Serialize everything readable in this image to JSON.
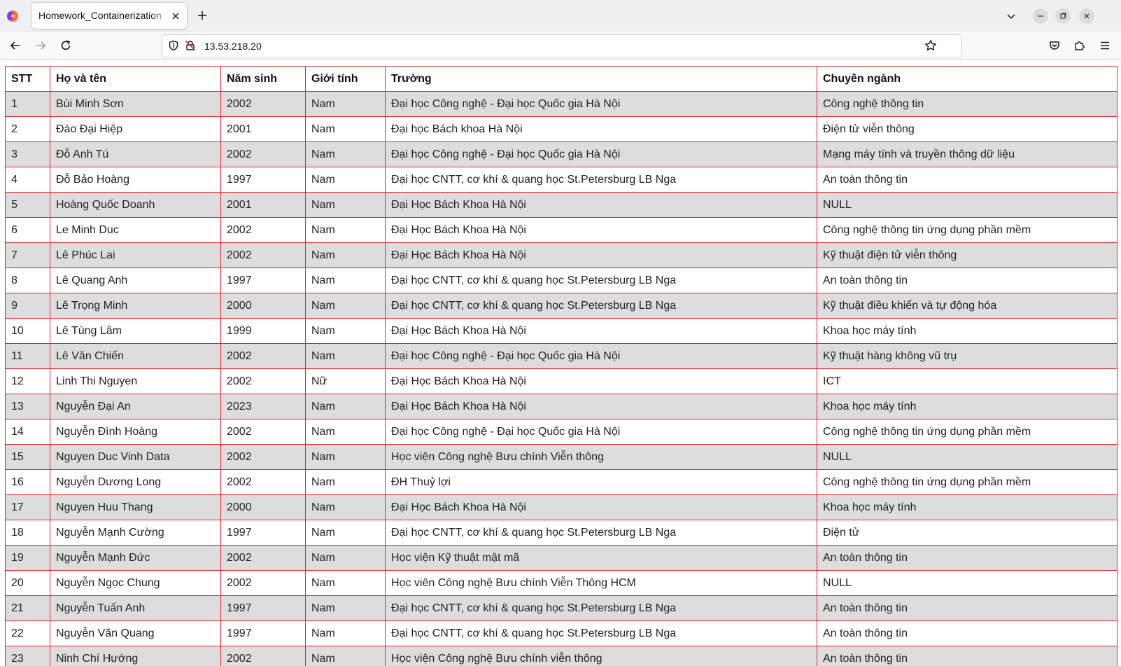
{
  "browser": {
    "tab_title": "Homework_Containerization",
    "url": "13.53.218.20"
  },
  "icons": {
    "back": "back-arrow-icon",
    "forward": "forward-arrow-icon",
    "reload": "reload-icon",
    "shield": "tracking-protection-icon",
    "lock": "insecure-lock-icon",
    "bookmark": "bookmark-star-icon",
    "pocket": "pocket-icon",
    "extensions": "extensions-icon",
    "menu": "hamburger-menu-icon"
  },
  "colors": {
    "table_border": "#e3232f",
    "row_stripe": "#dddddd"
  },
  "table": {
    "headers": [
      "STT",
      "Họ và tên",
      "Năm sinh",
      "Giới tính",
      "Trường",
      "Chuyên ngành"
    ],
    "rows": [
      [
        "1",
        "Bùi Minh Sơn",
        "2002",
        "Nam",
        "Đại học Công nghệ - Đại học Quốc gia Hà Nội",
        "Công nghệ thông tin"
      ],
      [
        "2",
        "Đào Đại Hiệp",
        "2001",
        "Nam",
        "Đại học Bách khoa Hà Nội",
        "Điện tử viễn thông"
      ],
      [
        "3",
        "Đỗ Anh Tú",
        "2002",
        "Nam",
        "Đại học Công nghệ - Đại học Quốc gia Hà Nội",
        "Mạng máy tính và truyền thông dữ liệu"
      ],
      [
        "4",
        "Đỗ Bảo Hoàng",
        "1997",
        "Nam",
        "Đại học CNTT, cơ khí & quang học St.Petersburg LB Nga",
        "An toàn thông tin"
      ],
      [
        "5",
        "Hoàng Quốc Doanh",
        "2001",
        "Nam",
        "Đại Học Bách Khoa Hà Nội",
        "NULL"
      ],
      [
        "6",
        "Le Minh Duc",
        "2002",
        "Nam",
        "Đại Học Bách Khoa Hà Nội",
        "Công nghệ thông tin ứng dụng phần mềm"
      ],
      [
        "7",
        "Lê Phúc Lai",
        "2002",
        "Nam",
        "Đại Học Bách Khoa Hà Nội",
        "Kỹ thuật điện tử viễn thông"
      ],
      [
        "8",
        "Lê Quang Anh",
        "1997",
        "Nam",
        "Đại học CNTT, cơ khí & quang học St.Petersburg LB Nga",
        "An toàn thông tin"
      ],
      [
        "9",
        "Lê Trọng Minh",
        "2000",
        "Nam",
        "Đại học CNTT, cơ khí & quang học St.Petersburg LB Nga",
        "Kỹ thuật điều khiển và tự động hóa"
      ],
      [
        "10",
        "Lê Tùng Lâm",
        "1999",
        "Nam",
        "Đại Học Bách Khoa Hà Nội",
        "Khoa học máy tính"
      ],
      [
        "11",
        "Lê Văn Chiến",
        "2002",
        "Nam",
        "Đại học Công nghệ - Đại học Quốc gia Hà Nội",
        "Kỹ thuật hàng không vũ trụ"
      ],
      [
        "12",
        "Linh Thi Nguyen",
        "2002",
        "Nữ",
        "Đại Học Bách Khoa Hà Nội",
        "ICT"
      ],
      [
        "13",
        "Nguyễn Đại An",
        "2023",
        "Nam",
        "Đại Học Bách Khoa Hà Nội",
        "Khoa học máy tính"
      ],
      [
        "14",
        "Nguyễn Đình Hoàng",
        "2002",
        "Nam",
        "Đại học Công nghệ - Đại học Quốc gia Hà Nội",
        "Công nghệ thông tin ứng dụng phần mềm"
      ],
      [
        "15",
        "Nguyen Duc Vinh Data",
        "2002",
        "Nam",
        "Học viện Công nghệ Bưu chính Viễn thông",
        "NULL"
      ],
      [
        "16",
        "Nguyễn Dương Long",
        "2002",
        "Nam",
        "ĐH Thuỷ lợi",
        "Công nghệ thông tin ứng dụng phần mềm"
      ],
      [
        "17",
        "Nguyen Huu Thang",
        "2000",
        "Nam",
        "Đại Học Bách Khoa Hà Nội",
        "Khoa học máy tính"
      ],
      [
        "18",
        "Nguyễn Mạnh Cường",
        "1997",
        "Nam",
        "Đại học CNTT, cơ khí & quang học St.Petersburg LB Nga",
        "Điện tử"
      ],
      [
        "19",
        "Nguyễn Mạnh Đức",
        "2002",
        "Nam",
        "Học viện Kỹ thuật mật mã",
        "An toàn thông tin"
      ],
      [
        "20",
        "Nguyễn Ngọc Chung",
        "2002",
        "Nam",
        "Học viên Công nghệ Bưu chính Viễn Thông HCM",
        "NULL"
      ],
      [
        "21",
        "Nguyễn Tuấn Anh",
        "1997",
        "Nam",
        "Đại học CNTT, cơ khí & quang học St.Petersburg LB Nga",
        "An toàn thông tin"
      ],
      [
        "22",
        "Nguyễn Văn Quang",
        "1997",
        "Nam",
        "Đại học CNTT, cơ khí & quang học St.Petersburg LB Nga",
        "An toàn thông tin"
      ],
      [
        "23",
        "Ninh Chí Hướng",
        "2002",
        "Nam",
        "Học viện Công nghệ Bưu chính viễn thông",
        "An toàn thông tin"
      ]
    ]
  }
}
